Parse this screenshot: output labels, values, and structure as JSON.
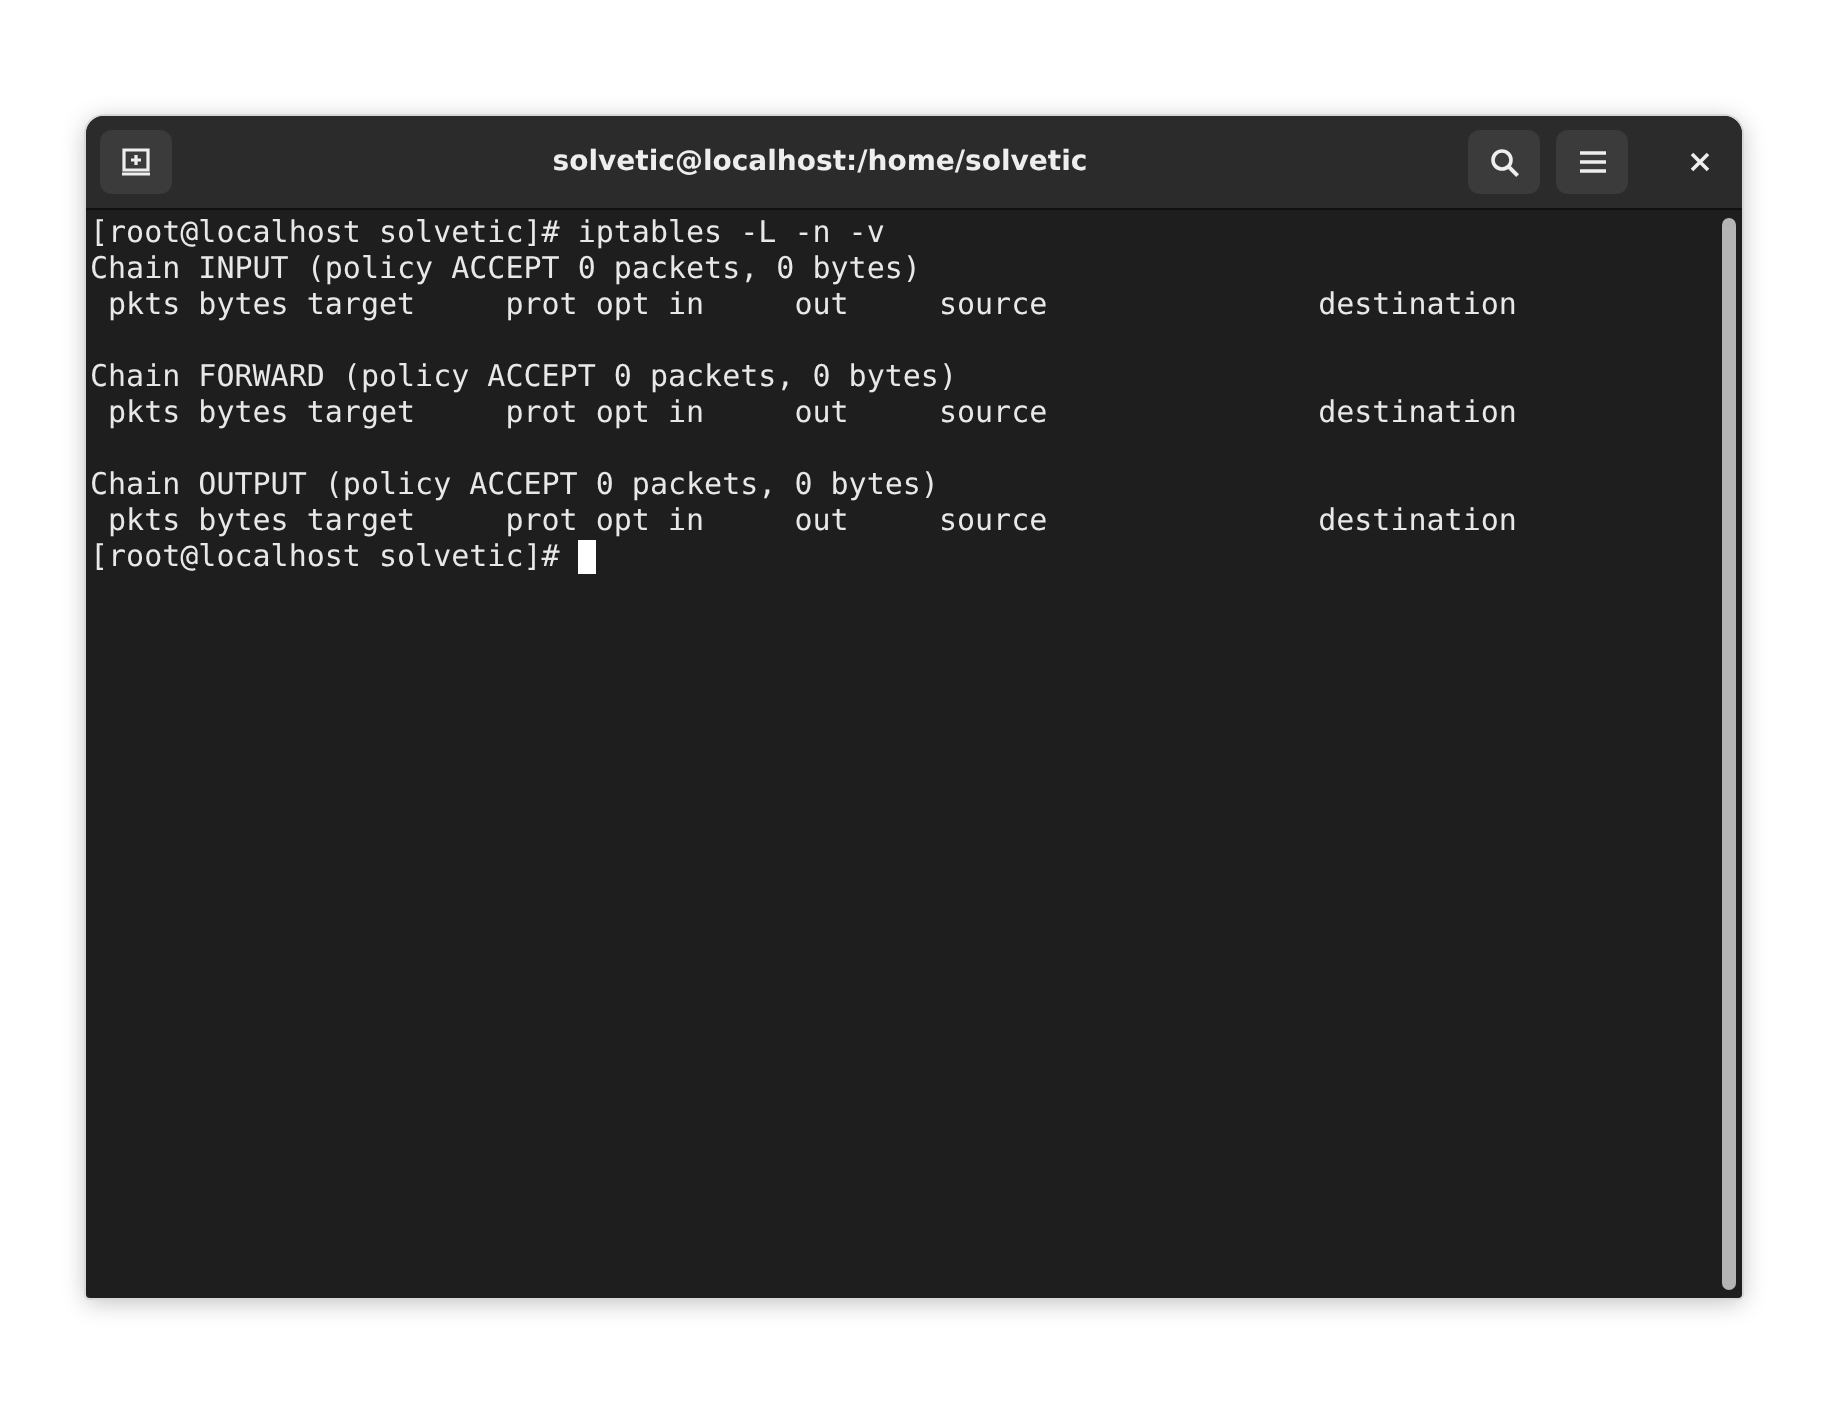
{
  "window": {
    "title": "solvetic@localhost:/home/solvetic"
  },
  "terminal": {
    "blocks": [
      [
        "[root@localhost solvetic]# iptables -L -n -v",
        "Chain INPUT (policy ACCEPT 0 packets, 0 bytes)",
        " pkts bytes target     prot opt in     out     source               destination"
      ],
      [
        "Chain FORWARD (policy ACCEPT 0 packets, 0 bytes)",
        " pkts bytes target     prot opt in     out     source               destination"
      ],
      [
        "Chain OUTPUT (policy ACCEPT 0 packets, 0 bytes)",
        " pkts bytes target     prot opt in     out     source               destination"
      ]
    ],
    "prompt": "[root@localhost solvetic]# ",
    "cursor": true
  }
}
